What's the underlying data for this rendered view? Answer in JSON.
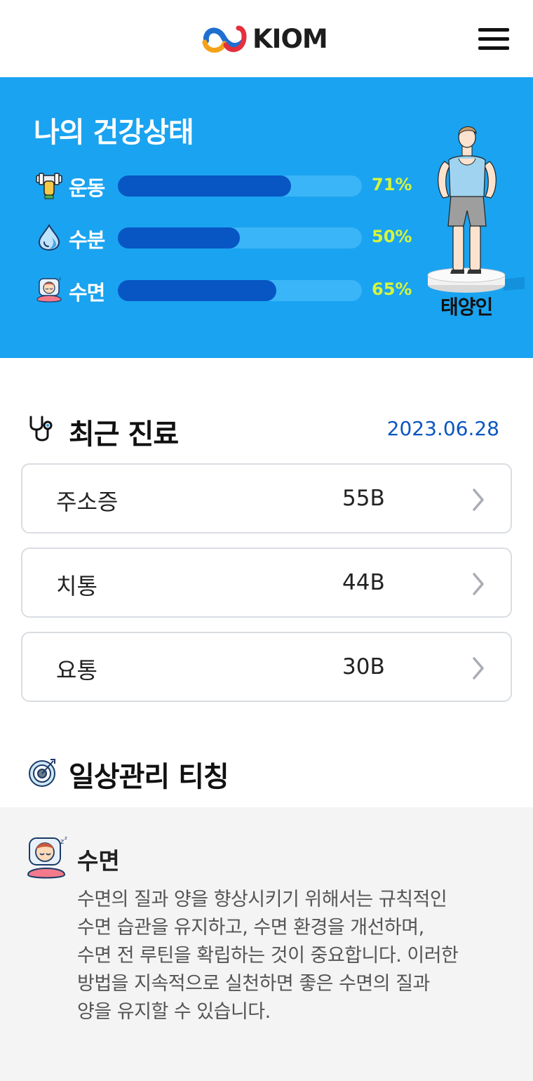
{
  "header": {
    "brand": "KIOM",
    "colors": {
      "logo_orange": "#f4a21a",
      "logo_blue": "#1f6fd1",
      "logo_red": "#e52f3d"
    }
  },
  "health": {
    "title": "나의 건강상태",
    "stats": [
      {
        "label": "운동",
        "percent_text": "71%",
        "value": 0.71,
        "icon": "dumbbell-icon"
      },
      {
        "label": "수분",
        "percent_text": "50%",
        "value": 0.5,
        "icon": "water-drop-icon"
      },
      {
        "label": "수면",
        "percent_text": "65%",
        "value": 0.65,
        "icon": "sleeping-face-icon"
      }
    ],
    "constitution_type": "태양인",
    "colors": {
      "background": "#1aa3f0",
      "bar_track": "#3ab5f7",
      "bar_fill": "#0756c4",
      "percent": "#d6f53a"
    }
  },
  "recent": {
    "title": "최근 진료",
    "date": "2023.06.28",
    "items": [
      {
        "name": "주소증",
        "code": "55B"
      },
      {
        "name": "치통",
        "code": "44B"
      },
      {
        "name": "요통",
        "code": "30B"
      }
    ]
  },
  "tips": {
    "title": "일상관리 티칭",
    "card": {
      "title": "수면",
      "lines": [
        "수면의 질과 양을 향상시키기 위해서는 규칙적인",
        "수면 습관을 유지하고, 수면 환경을 개선하며,",
        "수면 전 루틴을 확립하는 것이 중요합니다. 이러한",
        "방법을 지속적으로 실천하면 좋은 수면의 질과",
        "양을 유지할 수 있습니다."
      ]
    }
  }
}
